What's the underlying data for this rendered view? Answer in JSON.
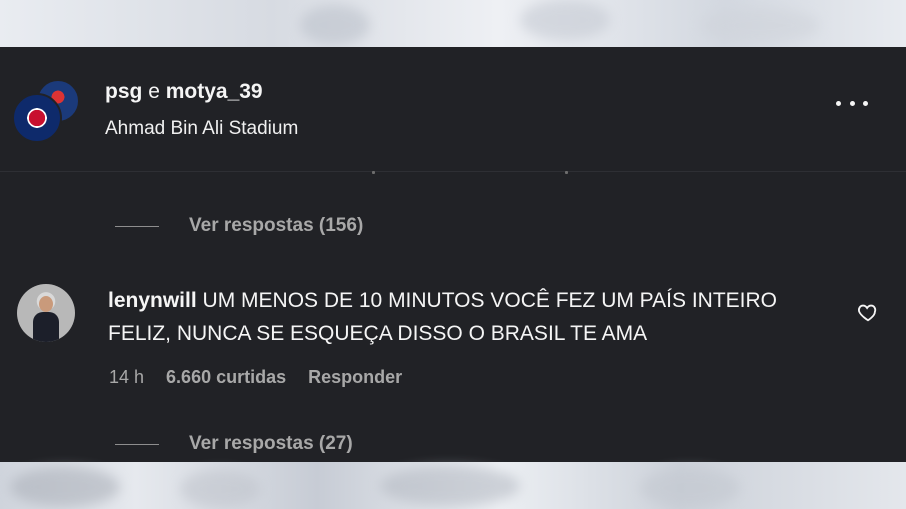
{
  "header": {
    "user_1": "psg",
    "conjunction": "e",
    "user_2": "motya_39",
    "location": "Ahmad Bin Ali Stadium",
    "more_icon": "more-horizontal-icon"
  },
  "replies_1": {
    "label": "Ver respostas (156)"
  },
  "comment": {
    "username": "lenynwill",
    "text": "UM MENOS DE 10 MINUTOS VOCÊ FEZ UM PAÍS INTEIRO FELIZ, NUNCA SE ESQUEÇA DISSO O BRASIL TE AMA",
    "time": "14 h",
    "likes": "6.660 curtidas",
    "reply_label": "Responder",
    "like_icon": "heart-icon"
  },
  "replies_2": {
    "label": "Ver respostas (27)"
  },
  "colors": {
    "panel_bg": "#212226",
    "text_primary": "#f5f5f5",
    "text_secondary": "#a8a8a8"
  }
}
